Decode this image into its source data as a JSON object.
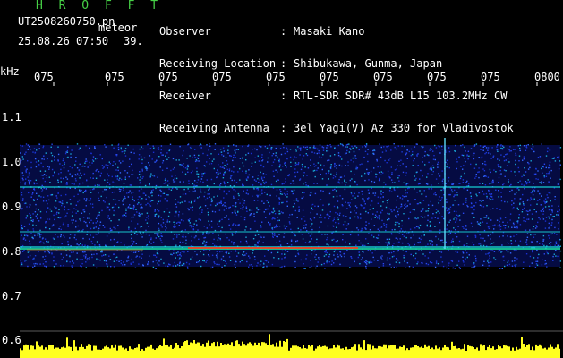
{
  "header": {
    "program": "H R O F F T",
    "filename": "UT2508260750.pn",
    "meteor_label": "meteor",
    "datetime": "25.08.26 07:50",
    "count": "39."
  },
  "station": {
    "rows": [
      {
        "label": "Observer",
        "sep": ":",
        "value": "Masaki Kano"
      },
      {
        "label": "Receiving Location",
        "sep": ":",
        "value": "Shibukawa, Gunma, Japan"
      },
      {
        "label": "Receiver",
        "sep": ":",
        "value": "RTL-SDR SDR# 43dB L15 103.2MHz CW"
      },
      {
        "label": "Receiving Antenna",
        "sep": ":",
        "value": "3el Yagi(V) Az 330 for Vladivostok"
      }
    ]
  },
  "axes": {
    "y_unit": "kHz",
    "y_ticks": [
      "1.1",
      "1.0",
      "0.9",
      "0.8",
      "0.7",
      "0.6"
    ],
    "x_ticks": [
      "075",
      "075",
      "075",
      "075",
      "075",
      "075",
      "075",
      "075",
      "075",
      "0800"
    ]
  },
  "colors": {
    "text": "#ffffff",
    "title_green": "#46d046",
    "noise_blue": "#1a2fd0",
    "echo_cyan": "#19d8d8",
    "echo_red": "#ff3a1a",
    "level_yellow": "#ffff20"
  }
}
